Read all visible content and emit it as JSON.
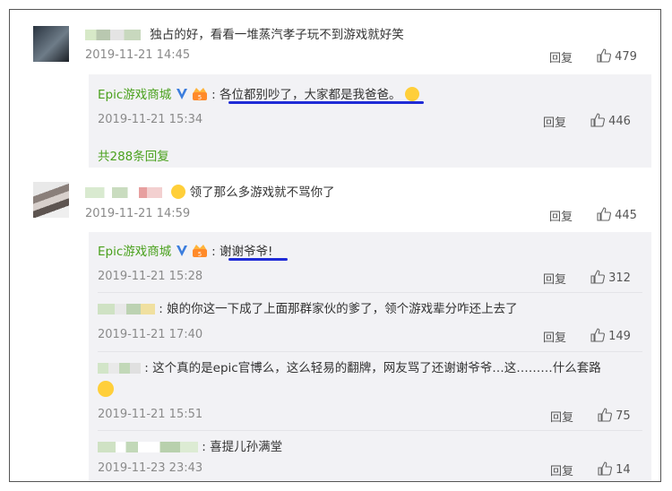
{
  "comments": [
    {
      "text": "独占的好，看看一堆蒸汽孝子玩不到游戏就好笑",
      "time": "2019-11-21 14:45",
      "reply_label": "回复",
      "likes": "479",
      "replies": [
        {
          "name": "Epic游戏商城",
          "text": "各位都别吵了，大家都是我爸爸。",
          "time": "2019-11-21 15:34",
          "reply_label": "回复",
          "likes": "446"
        }
      ],
      "more_replies": "共288条回复"
    },
    {
      "text": "领了那么多游戏就不骂你了",
      "time": "2019-11-21 14:59",
      "reply_label": "回复",
      "likes": "445",
      "replies": [
        {
          "name": "Epic游戏商城",
          "text": "谢谢爷爷!",
          "time": "2019-11-21 15:28",
          "reply_label": "回复",
          "likes": "312"
        },
        {
          "text": "娘的你这一下成了上面那群家伙的爹了，领个游戏辈分咋还上去了",
          "time": "2019-11-21 17:40",
          "reply_label": "回复",
          "likes": "149"
        },
        {
          "text": "这个真的是epic官博么，这么轻易的翻牌，网友骂了还谢谢爷爷…这………什么套路",
          "time": "2019-11-21 15:51",
          "reply_label": "回复",
          "likes": "75"
        },
        {
          "text": "喜提儿孙满堂",
          "time": "2019-11-23 23:43",
          "reply_label": "回复",
          "likes": "14"
        }
      ]
    }
  ],
  "icons": {
    "like": "thumbs-up-icon",
    "verified": "verified-v-icon",
    "crown": "crown-badge-icon",
    "emoji": "emoji-icon"
  },
  "colors": {
    "epic_name": "#4aa11d",
    "underline": "#1f2bd6",
    "reply_bg": "#f2f2f5"
  }
}
